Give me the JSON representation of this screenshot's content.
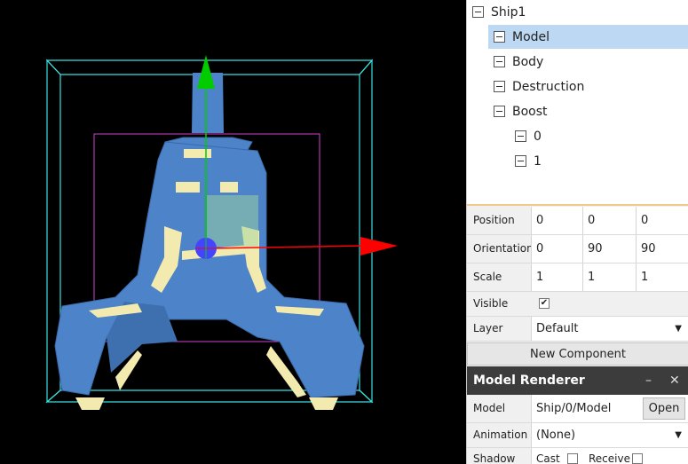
{
  "tree": {
    "items": [
      {
        "label": "Ship1"
      },
      {
        "label": "Model"
      },
      {
        "label": "Body"
      },
      {
        "label": "Destruction"
      },
      {
        "label": "Boost"
      },
      {
        "label": "0"
      },
      {
        "label": "1"
      }
    ]
  },
  "transform": {
    "position_label": "Position",
    "position": [
      "0",
      "0",
      "0"
    ],
    "orientation_label": "Orientation",
    "orientation": [
      "0",
      "90",
      "90"
    ],
    "scale_label": "Scale",
    "scale": [
      "1",
      "1",
      "1"
    ],
    "visible_label": "Visible",
    "visible_check": "✔",
    "layer_label": "Layer",
    "layer_value": "Default",
    "dropdown_arrow": "▼"
  },
  "new_component_label": "New Component",
  "component": {
    "title": "Model Renderer",
    "minimize_icon": "–",
    "close_icon": "✕",
    "model_label": "Model",
    "model_value": "Ship/0/Model",
    "open_label": "Open",
    "animation_label": "Animation",
    "animation_value": "(None)",
    "shadow_label": "Shadow",
    "cast_label": "Cast",
    "receive_label": "Receive"
  },
  "colors": {
    "accent_selected": "#bcd8f2",
    "gizmo_x": "#ff0000",
    "gizmo_y": "#00cc00",
    "gizmo_center": "#4444ff",
    "bounds_cyan": "#39e0e0",
    "bounds_magenta": "#d040d0",
    "ship_blue": "#4d83c9",
    "ship_cream": "#f3eab0"
  }
}
